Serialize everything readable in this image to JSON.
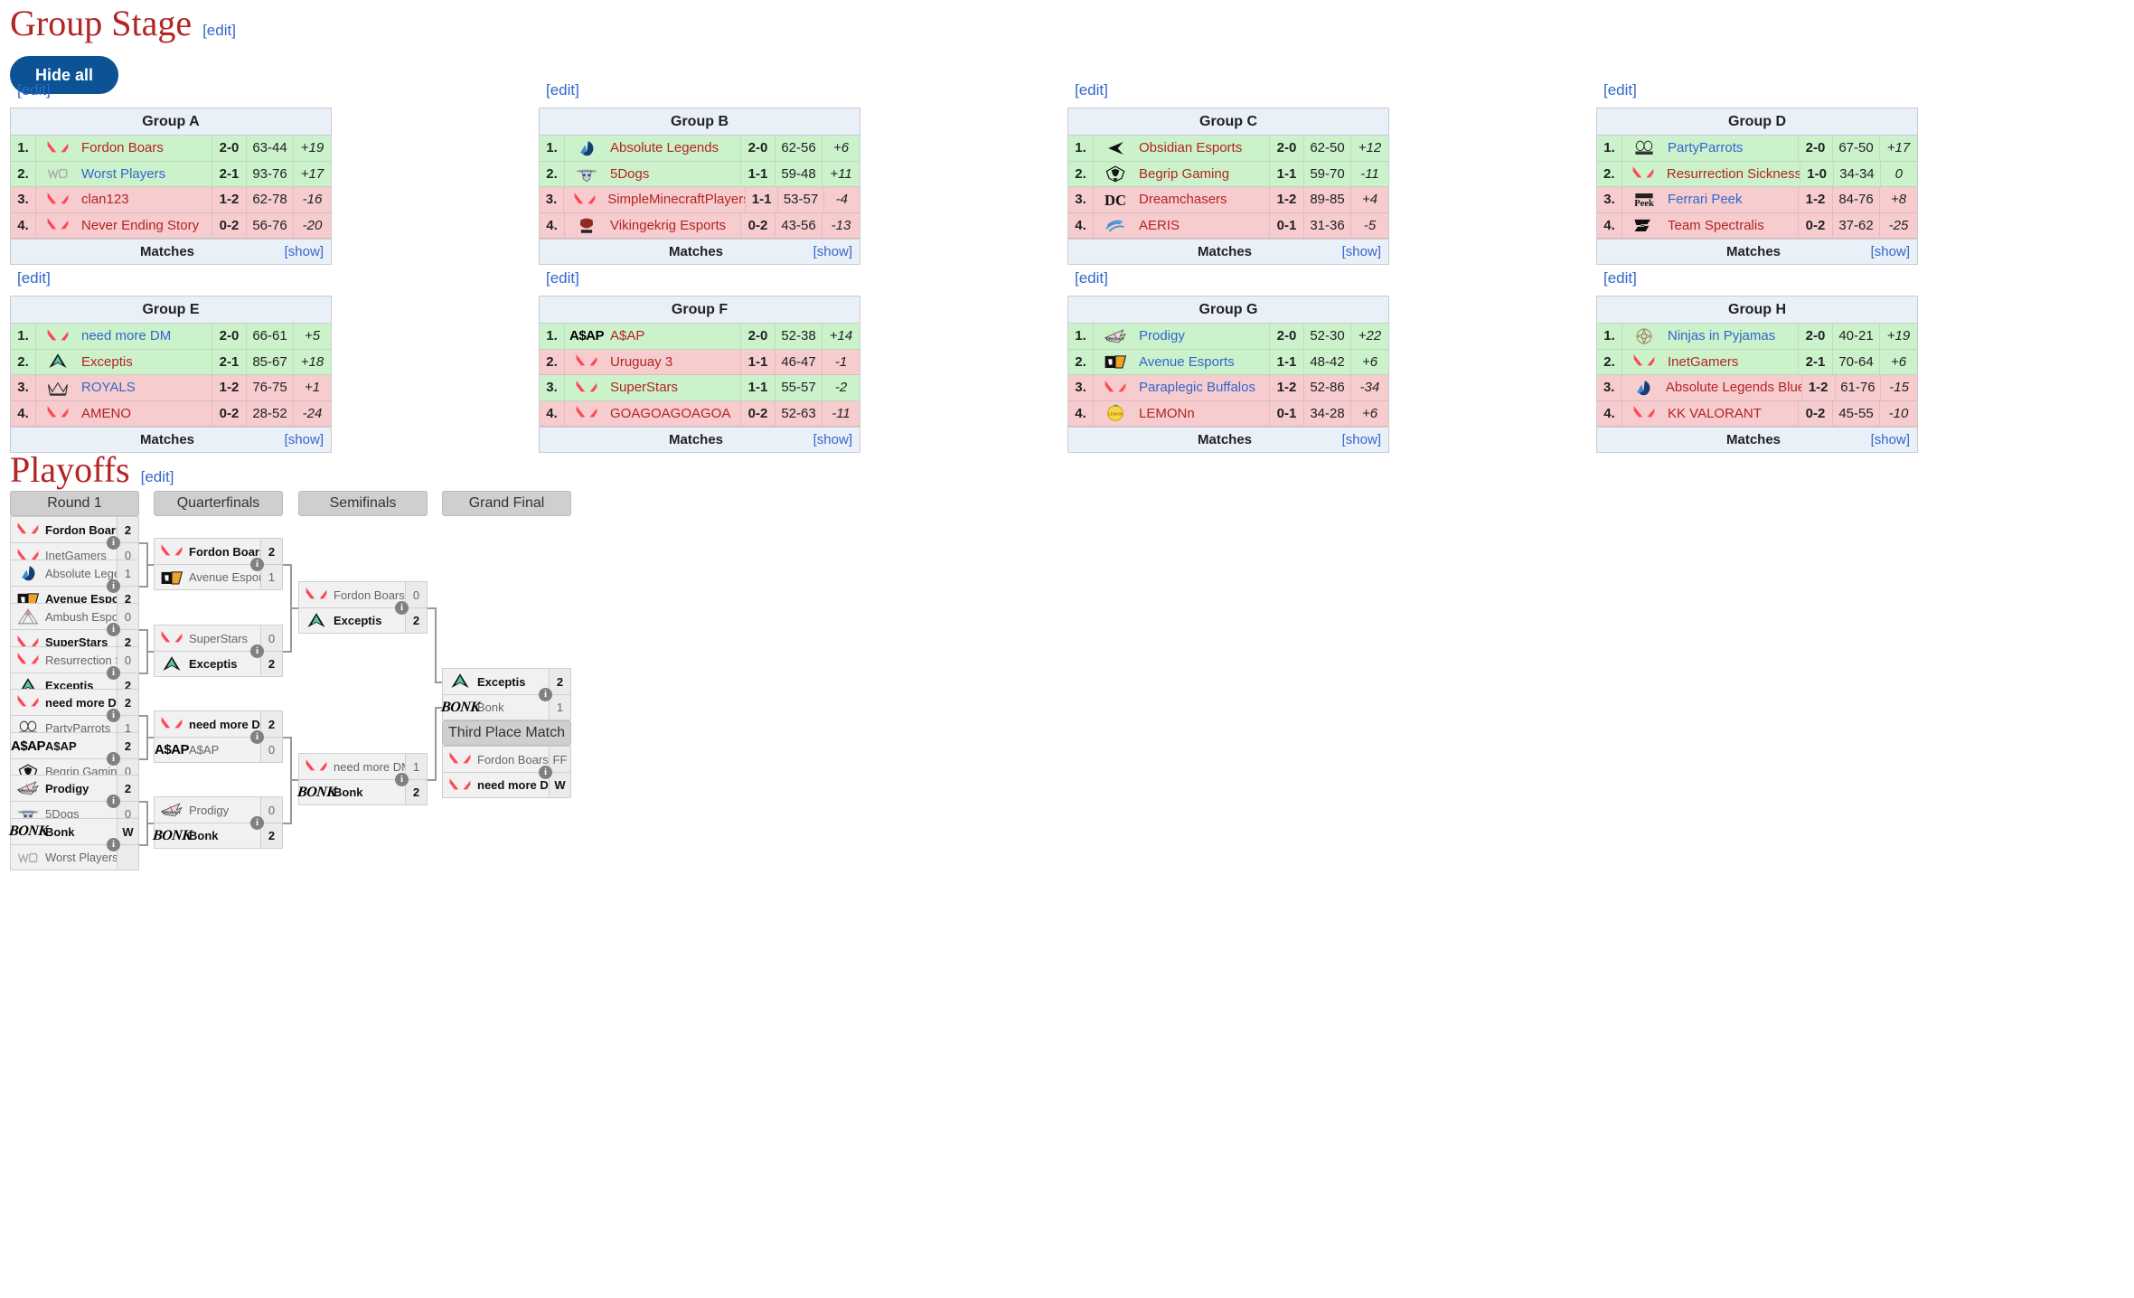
{
  "group_stage": {
    "title": "Group Stage",
    "edit_label": "[edit]",
    "hide_all_label": "Hide all",
    "matches_label": "Matches",
    "show_label": "[show]",
    "groups": [
      {
        "name": "Group A",
        "rows": [
          {
            "rank": "1.",
            "team": "Fordon Boars",
            "logo": "valorant-icon",
            "wl": "2-0",
            "rd": "63-44",
            "diff": "+19",
            "state": "green",
            "link": "red"
          },
          {
            "rank": "2.",
            "team": "Worst Players",
            "logo": "worst-players-icon",
            "wl": "2-1",
            "rd": "93-76",
            "diff": "+17",
            "state": "green",
            "link": "blue"
          },
          {
            "rank": "3.",
            "team": "clan123",
            "logo": "valorant-icon",
            "wl": "1-2",
            "rd": "62-78",
            "diff": "-16",
            "state": "red",
            "link": "red"
          },
          {
            "rank": "4.",
            "team": "Never Ending Story",
            "logo": "valorant-icon",
            "wl": "0-2",
            "rd": "56-76",
            "diff": "-20",
            "state": "red",
            "link": "red"
          }
        ]
      },
      {
        "name": "Group B",
        "rows": [
          {
            "rank": "1.",
            "team": "Absolute Legends",
            "logo": "absolute-legends-icon",
            "wl": "2-0",
            "rd": "62-56",
            "diff": "+6",
            "state": "green",
            "link": "red"
          },
          {
            "rank": "2.",
            "team": "5Dogs",
            "logo": "5dogs-icon",
            "wl": "1-1",
            "rd": "59-48",
            "diff": "+11",
            "state": "green",
            "link": "red"
          },
          {
            "rank": "3.",
            "team": "SimpleMinecraftPlayers",
            "logo": "valorant-icon",
            "wl": "1-1",
            "rd": "53-57",
            "diff": "-4",
            "state": "red",
            "link": "red"
          },
          {
            "rank": "4.",
            "team": "Vikingekrig Esports",
            "logo": "vikingekrig-icon",
            "wl": "0-2",
            "rd": "43-56",
            "diff": "-13",
            "state": "red",
            "link": "red"
          }
        ]
      },
      {
        "name": "Group C",
        "rows": [
          {
            "rank": "1.",
            "team": "Obsidian Esports",
            "logo": "obsidian-icon",
            "wl": "2-0",
            "rd": "62-50",
            "diff": "+12",
            "state": "green",
            "link": "red"
          },
          {
            "rank": "2.",
            "team": "Begrip Gaming",
            "logo": "begrip-icon",
            "wl": "1-1",
            "rd": "59-70",
            "diff": "-11",
            "state": "green",
            "link": "red"
          },
          {
            "rank": "3.",
            "team": "Dreamchasers",
            "logo": "dreamchasers-icon",
            "wl": "1-2",
            "rd": "89-85",
            "diff": "+4",
            "state": "red",
            "link": "red"
          },
          {
            "rank": "4.",
            "team": "AERIS",
            "logo": "aeris-icon",
            "wl": "0-1",
            "rd": "31-36",
            "diff": "-5",
            "state": "red",
            "link": "red"
          }
        ]
      },
      {
        "name": "Group D",
        "rows": [
          {
            "rank": "1.",
            "team": "PartyParrots",
            "logo": "partyparrots-icon",
            "wl": "2-0",
            "rd": "67-50",
            "diff": "+17",
            "state": "green",
            "link": "blue"
          },
          {
            "rank": "2.",
            "team": "Resurrection Sickness",
            "logo": "valorant-icon",
            "wl": "1-0",
            "rd": "34-34",
            "diff": "0",
            "state": "green",
            "link": "red"
          },
          {
            "rank": "3.",
            "team": "Ferrari Peek",
            "logo": "ferraripeek-icon",
            "wl": "1-2",
            "rd": "84-76",
            "diff": "+8",
            "state": "red",
            "link": "blue"
          },
          {
            "rank": "4.",
            "team": "Team Spectralis",
            "logo": "spectralis-icon",
            "wl": "0-2",
            "rd": "37-62",
            "diff": "-25",
            "state": "red",
            "link": "red"
          }
        ]
      },
      {
        "name": "Group E",
        "rows": [
          {
            "rank": "1.",
            "team": "need more DM",
            "logo": "valorant-icon",
            "wl": "2-0",
            "rd": "66-61",
            "diff": "+5",
            "state": "green",
            "link": "blue"
          },
          {
            "rank": "2.",
            "team": "Exceptis",
            "logo": "exceptis-icon",
            "wl": "2-1",
            "rd": "85-67",
            "diff": "+18",
            "state": "green",
            "link": "red"
          },
          {
            "rank": "3.",
            "team": "ROYALS",
            "logo": "royals-icon",
            "wl": "1-2",
            "rd": "76-75",
            "diff": "+1",
            "state": "red",
            "link": "blue"
          },
          {
            "rank": "4.",
            "team": "AMENO",
            "logo": "valorant-icon",
            "wl": "0-2",
            "rd": "28-52",
            "diff": "-24",
            "state": "red",
            "link": "red"
          }
        ]
      },
      {
        "name": "Group F",
        "rows": [
          {
            "rank": "1.",
            "team": "A$AP",
            "logo": "asap-icon",
            "wl": "2-0",
            "rd": "52-38",
            "diff": "+14",
            "state": "green",
            "link": "red"
          },
          {
            "rank": "2.",
            "team": "Uruguay 3",
            "logo": "valorant-icon",
            "wl": "1-1",
            "rd": "46-47",
            "diff": "-1",
            "state": "red",
            "link": "red"
          },
          {
            "rank": "3.",
            "team": "SuperStars",
            "logo": "valorant-icon",
            "wl": "1-1",
            "rd": "55-57",
            "diff": "-2",
            "state": "green",
            "link": "red"
          },
          {
            "rank": "4.",
            "team": "GOAGOAGOAGOA",
            "logo": "valorant-icon",
            "wl": "0-2",
            "rd": "52-63",
            "diff": "-11",
            "state": "red",
            "link": "red"
          }
        ]
      },
      {
        "name": "Group G",
        "rows": [
          {
            "rank": "1.",
            "team": "Prodigy",
            "logo": "prodigy-icon",
            "wl": "2-0",
            "rd": "52-30",
            "diff": "+22",
            "state": "green",
            "link": "blue"
          },
          {
            "rank": "2.",
            "team": "Avenue Esports",
            "logo": "avenue-icon",
            "wl": "1-1",
            "rd": "48-42",
            "diff": "+6",
            "state": "green",
            "link": "blue"
          },
          {
            "rank": "3.",
            "team": "Paraplegic Buffalos",
            "logo": "valorant-icon",
            "wl": "1-2",
            "rd": "52-86",
            "diff": "-34",
            "state": "red",
            "link": "blue"
          },
          {
            "rank": "4.",
            "team": "LEMONn",
            "logo": "lemonn-icon",
            "wl": "0-1",
            "rd": "34-28",
            "diff": "+6",
            "state": "red",
            "link": "red"
          }
        ]
      },
      {
        "name": "Group H",
        "rows": [
          {
            "rank": "1.",
            "team": "Ninjas in Pyjamas",
            "logo": "nip-icon",
            "wl": "2-0",
            "rd": "40-21",
            "diff": "+19",
            "state": "green",
            "link": "blue"
          },
          {
            "rank": "2.",
            "team": "InetGamers",
            "logo": "valorant-icon",
            "wl": "2-1",
            "rd": "70-64",
            "diff": "+6",
            "state": "green",
            "link": "red"
          },
          {
            "rank": "3.",
            "team": "Absolute Legends Blue",
            "logo": "absolute-legends-icon",
            "wl": "1-2",
            "rd": "61-76",
            "diff": "-15",
            "state": "red",
            "link": "red"
          },
          {
            "rank": "4.",
            "team": "KK VALORANT",
            "logo": "valorant-icon",
            "wl": "0-2",
            "rd": "45-55",
            "diff": "-10",
            "state": "red",
            "link": "red"
          }
        ]
      }
    ]
  },
  "playoffs": {
    "title": "Playoffs",
    "edit_label": "[edit]",
    "round_headers": [
      "Round 1",
      "Quarterfinals",
      "Semifinals",
      "Grand Final",
      "Third Place Match"
    ],
    "info_glyph": "i",
    "round1": [
      {
        "top": {
          "team": "Fordon Boars",
          "logo": "valorant-icon",
          "score": "2",
          "winner": true
        },
        "bot": {
          "team": "InetGamers",
          "logo": "valorant-icon",
          "score": "0",
          "winner": false
        }
      },
      {
        "top": {
          "team": "Absolute Legends",
          "logo": "absolute-legends-icon",
          "score": "1",
          "winner": false
        },
        "bot": {
          "team": "Avenue Esports",
          "logo": "avenue-icon",
          "score": "2",
          "winner": true
        }
      },
      {
        "top": {
          "team": "Ambush Esport",
          "logo": "ambush-icon",
          "score": "0",
          "winner": false
        },
        "bot": {
          "team": "SuperStars",
          "logo": "valorant-icon",
          "score": "2",
          "winner": true
        }
      },
      {
        "top": {
          "team": "Resurrection Sickne...",
          "logo": "valorant-icon",
          "score": "0",
          "winner": false
        },
        "bot": {
          "team": "Exceptis",
          "logo": "exceptis-icon",
          "score": "2",
          "winner": true
        }
      },
      {
        "top": {
          "team": "need more DM",
          "logo": "valorant-icon",
          "score": "2",
          "winner": true
        },
        "bot": {
          "team": "PartyParrots",
          "logo": "partyparrots-icon",
          "score": "1",
          "winner": false
        }
      },
      {
        "top": {
          "team": "A$AP",
          "logo": "asap-icon",
          "score": "2",
          "winner": true
        },
        "bot": {
          "team": "Begrip Gaming",
          "logo": "begrip-icon",
          "score": "0",
          "winner": false
        }
      },
      {
        "top": {
          "team": "Prodigy",
          "logo": "prodigy-icon",
          "score": "2",
          "winner": true
        },
        "bot": {
          "team": "5Dogs",
          "logo": "5dogs-icon",
          "score": "0",
          "winner": false
        }
      },
      {
        "top": {
          "team": "Bonk",
          "logo": "bonk-icon",
          "score": "W",
          "winner": true
        },
        "bot": {
          "team": "Worst Players",
          "logo": "worst-players-icon",
          "score": "",
          "winner": false
        }
      }
    ],
    "quarterfinals": [
      {
        "top": {
          "team": "Fordon Boars",
          "logo": "valorant-icon",
          "score": "2",
          "winner": true
        },
        "bot": {
          "team": "Avenue Esports",
          "logo": "avenue-icon",
          "score": "1",
          "winner": false
        }
      },
      {
        "top": {
          "team": "SuperStars",
          "logo": "valorant-icon",
          "score": "0",
          "winner": false
        },
        "bot": {
          "team": "Exceptis",
          "logo": "exceptis-icon",
          "score": "2",
          "winner": true
        }
      },
      {
        "top": {
          "team": "need more DM",
          "logo": "valorant-icon",
          "score": "2",
          "winner": true
        },
        "bot": {
          "team": "A$AP",
          "logo": "asap-icon",
          "score": "0",
          "winner": false
        }
      },
      {
        "top": {
          "team": "Prodigy",
          "logo": "prodigy-icon",
          "score": "0",
          "winner": false
        },
        "bot": {
          "team": "Bonk",
          "logo": "bonk-icon",
          "score": "2",
          "winner": true
        }
      }
    ],
    "semifinals": [
      {
        "top": {
          "team": "Fordon Boars",
          "logo": "valorant-icon",
          "score": "0",
          "winner": false
        },
        "bot": {
          "team": "Exceptis",
          "logo": "exceptis-icon",
          "score": "2",
          "winner": true
        }
      },
      {
        "top": {
          "team": "need more DM",
          "logo": "valorant-icon",
          "score": "1",
          "winner": false
        },
        "bot": {
          "team": "Bonk",
          "logo": "bonk-icon",
          "score": "2",
          "winner": true
        }
      }
    ],
    "grand_final": {
      "top": {
        "team": "Exceptis",
        "logo": "exceptis-icon",
        "score": "2",
        "winner": true
      },
      "bot": {
        "team": "Bonk",
        "logo": "bonk-icon",
        "score": "1",
        "winner": false
      }
    },
    "third_place": {
      "top": {
        "team": "Fordon Boars",
        "logo": "valorant-icon",
        "score": "FF",
        "winner": false
      },
      "bot": {
        "team": "need more DM",
        "logo": "valorant-icon",
        "score": "W",
        "winner": true
      }
    }
  },
  "colors": {
    "heading_red": "#b32424",
    "link_blue": "#3366cc",
    "advance_green": "#ccf2cc",
    "eliminated_red": "#f7ccce",
    "table_header": "#eaf0f7",
    "button_blue": "#0b5394",
    "bracket_header_gray": "#cfcfcf"
  }
}
